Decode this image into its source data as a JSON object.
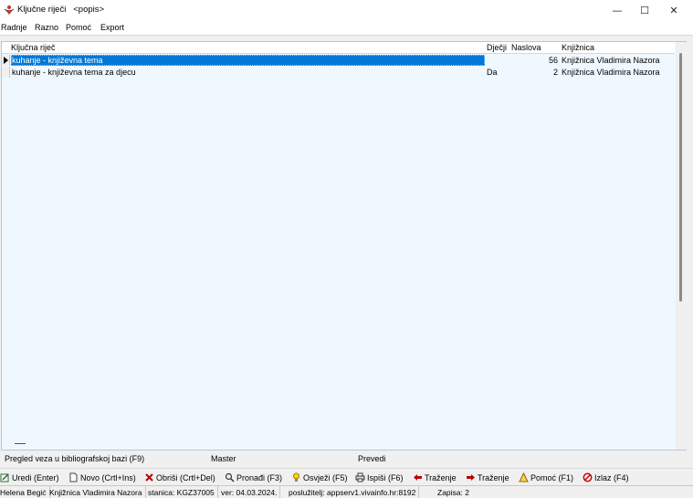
{
  "window": {
    "title": "Ključne riječi   <popis>",
    "minimize": "—",
    "maximize": "☐",
    "close": "✕"
  },
  "menu": {
    "items": [
      "Radnje",
      "Razno",
      "Pomoć",
      "Export"
    ]
  },
  "grid": {
    "columns": {
      "keyword": "Ključna riječ",
      "children": "Dječji",
      "titles": "Naslova",
      "library": "Knjižnica"
    },
    "rows": [
      {
        "keyword": "kuhanje - književna tema",
        "children": "",
        "titles": "56",
        "library": "Knjižnica Vladimira Nazora",
        "selected": true
      },
      {
        "keyword": "kuhanje - književna tema za djecu",
        "children": "Da",
        "titles": "2",
        "library": "Knjižnica Vladimira Nazora",
        "selected": false
      }
    ]
  },
  "details": {
    "links_label": "Pregled veza u bibliografskoj bazi (F9)",
    "master_label": "Master",
    "translate_label": "Prevedi"
  },
  "toolbar": {
    "edit": "Uredi (Enter)",
    "new": "Novo (Crtl+Ins)",
    "delete": "Obriši (Crtl+Del)",
    "find": "Pronađi (F3)",
    "refresh": "Osvježi (F5)",
    "print": "Ispiši (F6)",
    "search_back": "Traženje",
    "search_forward": "Traženje",
    "help": "Pomoć (F1)",
    "exit": "Izlaz (F4)"
  },
  "status": {
    "user": "Helena Begić",
    "library": "Knjižnica Vladimira Nazora",
    "station": "stanica: KGZ37005",
    "version": "ver: 04.03.2024.",
    "server": "poslužitelj: appserv1.vivainfo.hr:8192",
    "records": "Zapisa: 2"
  },
  "colors": {
    "selection": "#0078d7",
    "grid_background": "#f0f8ff",
    "delete_icon": "#c00000",
    "exit_icon": "#d00000"
  }
}
